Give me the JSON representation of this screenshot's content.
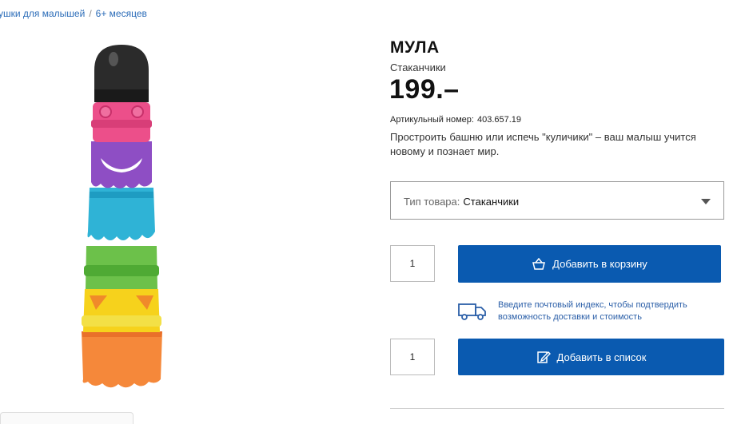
{
  "breadcrumb": {
    "items": [
      "ушки для малышей",
      "6+ месяцев"
    ],
    "separator": "/"
  },
  "product": {
    "name": "МУЛА",
    "type": "Стаканчики",
    "price": "199.–",
    "article_label": "Артикульный номер:",
    "article_number": "403.657.19",
    "description": "Простроить башню или испечь \"куличики\" – ваш малыш учится новому и познает мир."
  },
  "variant_select": {
    "label": "Тип товара:",
    "value": "Стаканчики"
  },
  "cart": {
    "quantity": "1",
    "button_label": "Добавить в корзину",
    "icon": "basket-icon"
  },
  "delivery": {
    "text_line1": "Введите почтовый индекс, чтобы подтвердить",
    "text_line2": "возможность доставки и стоимость",
    "icon": "truck-icon"
  },
  "list": {
    "quantity": "1",
    "button_label": "Добавить в список",
    "icon": "edit-list-icon"
  },
  "colors": {
    "primary_button": "#0a5ab0",
    "link": "#2b6cb8"
  }
}
